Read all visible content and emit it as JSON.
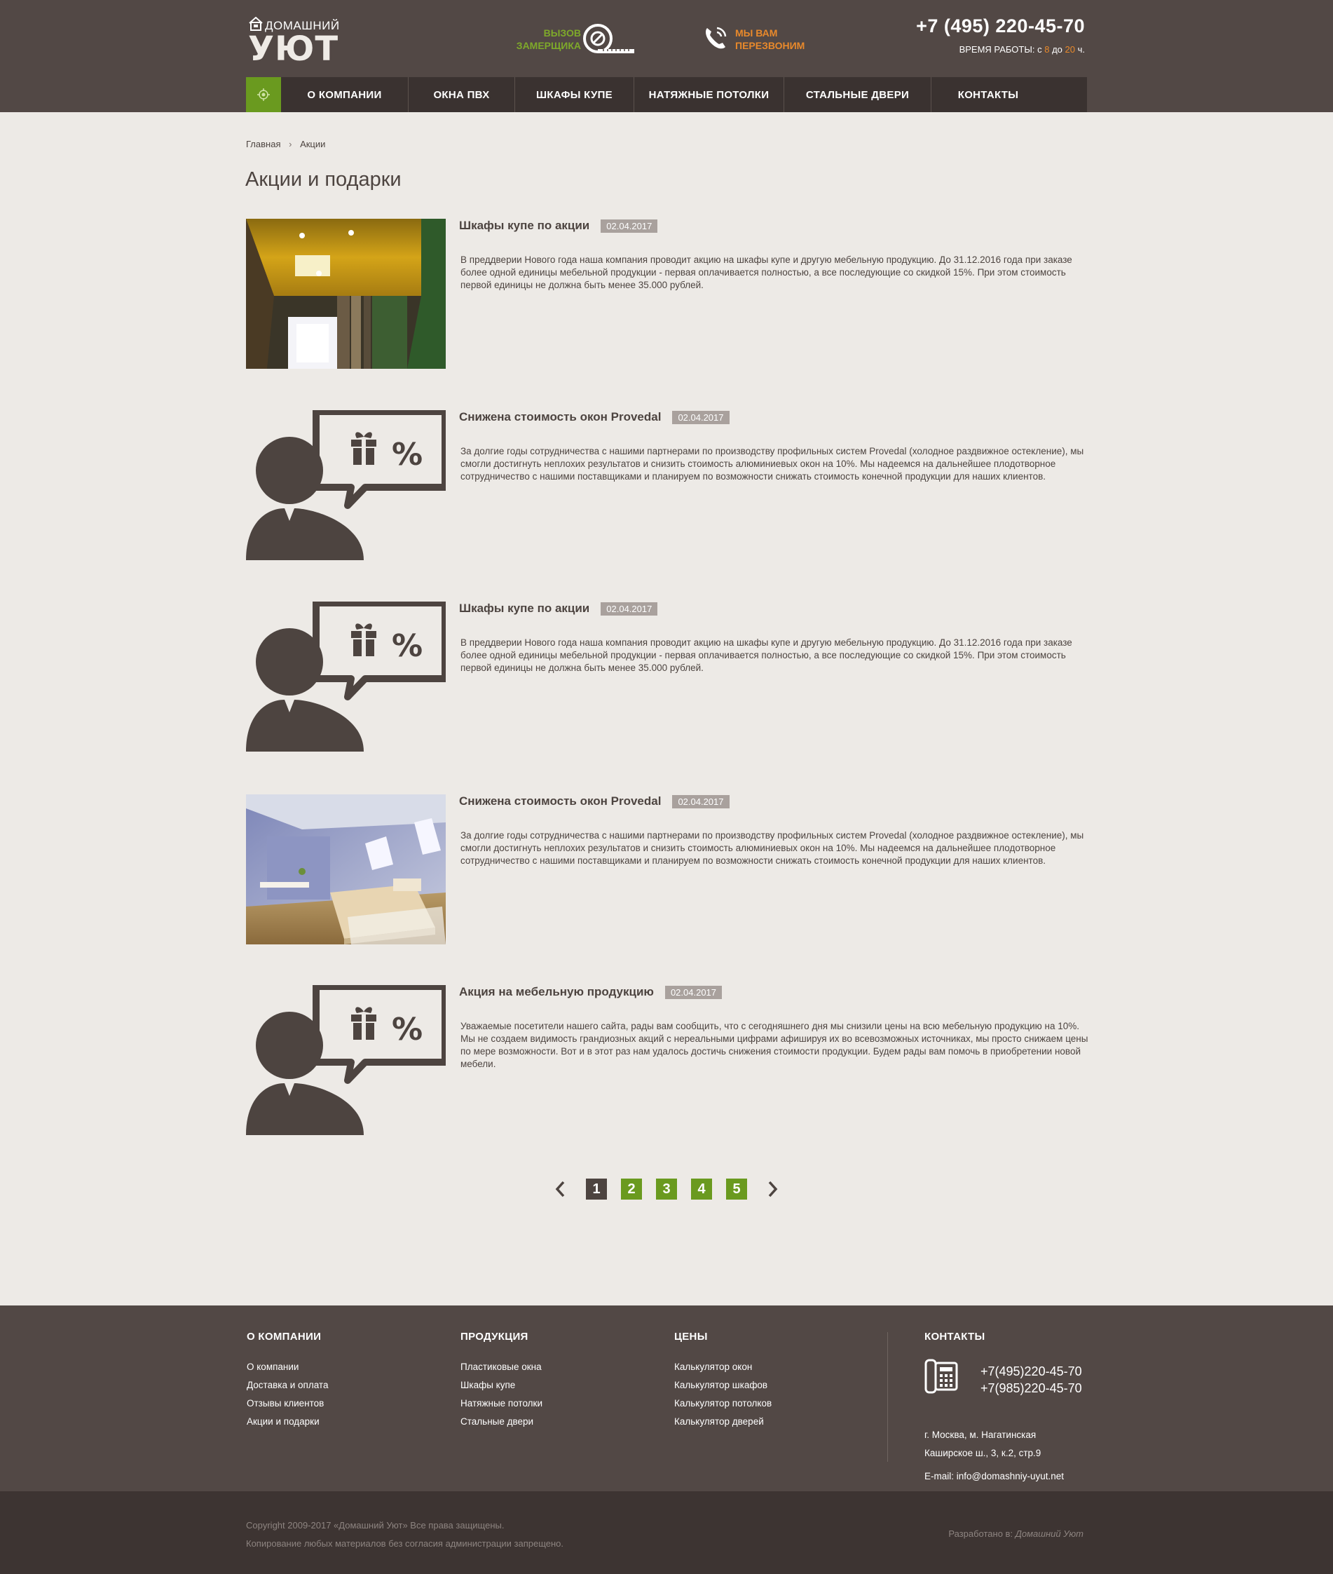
{
  "header": {
    "logo_top": "ДОМАШНИЙ",
    "logo_big": "УЮТ",
    "measure_line1": "ВЫЗОВ",
    "measure_line2": "ЗАМЕРЩИКА",
    "callback_line1": "МЫ ВАМ",
    "callback_line2": "ПЕРЕЗВОНИМ",
    "phone": "+7 (495) 220-45-70",
    "hours_prefix": "ВРЕМЯ РАБОТЫ: с",
    "hours_from": "8",
    "hours_mid": "до",
    "hours_to": "20",
    "hours_suffix": "ч."
  },
  "nav": {
    "items": [
      "О КОМПАНИИ",
      "ОКНА ПВХ",
      "ШКАФЫ КУПЕ",
      "НАТЯЖНЫЕ ПОТОЛКИ",
      "СТАЛЬНЫЕ ДВЕРИ",
      "КОНТАКТЫ"
    ]
  },
  "breadcrumb": {
    "home": "Главная",
    "current": "Акции"
  },
  "page_title": "Акции и подарки",
  "promos": [
    {
      "title": "Шкафы купе по акции",
      "date": "02.04.2017",
      "image": "ceiling-photo",
      "text": "В преддверии Нового года наша компания проводит акцию на шкафы купе и другую мебельную продукцию. До 31.12.2016 года при заказе более одной единицы мебельной продукции - первая оплачивается полностью, а все последующие со скидкой 15%. При этом стоимость первой единицы не должна быть менее 35.000 рублей."
    },
    {
      "title": "Снижена стоимость окон Provedal",
      "date": "02.04.2017",
      "image": "promo-icon",
      "text": "За долгие годы сотрудничества с нашими партнерами по производству профильных систем Provedal (холодное раздвижное остекление), мы смогли достигнуть неплохих результатов и снизить стоимость алюминиевых окон на 10%. Мы надеемся на дальнейшее плодотворное сотрудничество с нашими поставщиками и планируем по возможности снижать стоимость конечной продукции для наших клиентов."
    },
    {
      "title": "Шкафы купе по акции",
      "date": "02.04.2017",
      "image": "promo-icon",
      "text": "В преддверии Нового года наша компания проводит акцию на шкафы купе и другую мебельную продукцию. До 31.12.2016 года при заказе более одной единицы мебельной продукции - первая оплачивается полностью, а все последующие со скидкой 15%. При этом стоимость первой единицы не должна быть менее 35.000 рублей."
    },
    {
      "title": "Снижена стоимость окон Provedal",
      "date": "02.04.2017",
      "image": "bedroom-photo",
      "text": "За долгие годы сотрудничества с нашими партнерами по производству профильных систем Provedal (холодное раздвижное остекление), мы смогли достигнуть неплохих результатов и снизить стоимость алюминиевых окон на 10%. Мы надеемся на дальнейшее плодотворное сотрудничество с нашими поставщиками и планируем по возможности снижать стоимость конечной продукции для наших клиентов."
    },
    {
      "title": "Акция на мебельную продукцию",
      "date": "02.04.2017",
      "image": "promo-icon",
      "text": "Уважаемые посетители нашего сайта, рады вам сообщить, что с сегодняшнего дня мы снизили цены на всю мебельную продукцию на 10%. Мы не создаем видимость грандиозных акций с нереальными цифрами афишируя их во всевозможных источниках, мы просто снижаем цены по мере возможности. Вот и в этот раз нам удалось достичь снижения стоимости продукции. Будем рады вам помочь в приобретении новой мебели."
    }
  ],
  "pagination": {
    "pages": [
      "1",
      "2",
      "3",
      "4",
      "5"
    ],
    "current": "1"
  },
  "footer": {
    "col1": {
      "title": "О КОМПАНИИ",
      "links": [
        "О компании",
        "Доставка и оплата",
        "Отзывы клиентов",
        "Акции и подарки"
      ]
    },
    "col2": {
      "title": "ПРОДУКЦИЯ",
      "links": [
        "Пластиковые окна",
        "Шкафы купе",
        "Натяжные потолки",
        "Стальные двери"
      ]
    },
    "col3": {
      "title": "ЦЕНЫ",
      "links": [
        "Калькулятор окон",
        "Калькулятор шкафов",
        "Калькулятор потолков",
        "Калькулятор дверей"
      ]
    },
    "contacts": {
      "title": "КОНТАКТЫ",
      "phone1": "+7(495)220-45-70",
      "phone2": "+7(985)220-45-70",
      "addr1": "г. Москва, м. Нагатинская",
      "addr2": "Каширское ш., 3, к.2, стр.9",
      "email": "E-mail: info@domashniy-uyut.net"
    }
  },
  "bottom": {
    "copyright": "Copyright 2009-2017 «Домашний Уют» Все права защищены.",
    "notice": "Копирование любых материалов без согласия администрации запрещено.",
    "dev_prefix": "Разработано в:",
    "dev_name": "Домашний Уют"
  },
  "colors": {
    "header_bg": "#524845",
    "accent_green": "#6a9a1f",
    "accent_orange": "#e8892b",
    "page_bg": "#edeae6"
  }
}
